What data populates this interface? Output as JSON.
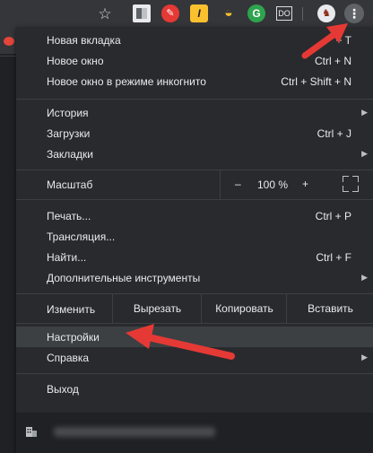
{
  "toolbar": {
    "ext_icons": [
      "star-icon",
      "extension-icon",
      "extension-icon",
      "extension-icon",
      "extension-icon",
      "grammarly-icon",
      "extension-icon"
    ],
    "ext_text": {
      "e3": "I",
      "e5": "G",
      "e6": "DO"
    }
  },
  "menu": {
    "items_group1": [
      {
        "label": "Новая вкладка",
        "shortcut": "+ T"
      },
      {
        "label": "Новое окно",
        "shortcut": "Ctrl + N"
      },
      {
        "label": "Новое окно в режиме инкогнито",
        "shortcut": "Ctrl + Shift + N"
      }
    ],
    "items_group2": [
      {
        "label": "История",
        "has_submenu": true
      },
      {
        "label": "Загрузки",
        "shortcut": "Ctrl + J"
      },
      {
        "label": "Закладки",
        "has_submenu": true
      }
    ],
    "zoom": {
      "label": "Масштаб",
      "minus": "–",
      "value": "100 %",
      "plus": "+"
    },
    "items_group3": [
      {
        "label": "Печать...",
        "shortcut": "Ctrl + P"
      },
      {
        "label": "Трансляция..."
      },
      {
        "label": "Найти...",
        "shortcut": "Ctrl + F"
      },
      {
        "label": "Дополнительные инструменты",
        "has_submenu": true
      }
    ],
    "edit": {
      "label": "Изменить",
      "cut": "Вырезать",
      "copy": "Копировать",
      "paste": "Вставить"
    },
    "items_group4": [
      {
        "label": "Настройки",
        "highlighted": true
      },
      {
        "label": "Справка",
        "has_submenu": true
      }
    ],
    "exit": {
      "label": "Выход"
    }
  },
  "colors": {
    "accent_arrow": "#e53935",
    "menu_bg": "#292a2d",
    "highlight": "#3c4043"
  }
}
